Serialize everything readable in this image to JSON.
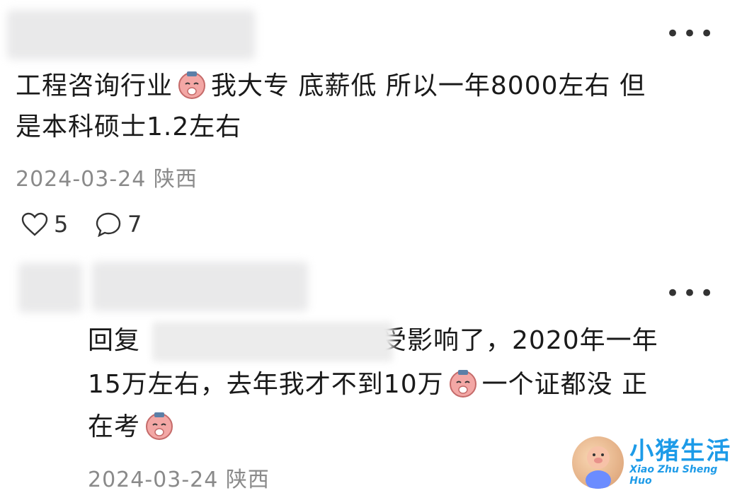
{
  "comment1": {
    "text_line1_part1": "工程咨询行业",
    "text_line1_part2": "我大专 底薪低 所以一年8000左右 但",
    "text_line2": "是本科硕士1.2左右",
    "date": "2024-03-24",
    "location": "陕西",
    "likes": "5",
    "replies": "7"
  },
  "comment2": {
    "reply_prefix": "回复",
    "line1_after": "受影响了，2020年一年",
    "line2_part1": "15万左右，去年我才不到10万",
    "line2_part2": "一个证都没 正",
    "line3": "在考",
    "date": "2024-03-24",
    "location": "陕西"
  },
  "watermark": {
    "title": "小猪生活",
    "subtitle": "Xiao Zhu Sheng Huo"
  },
  "colors": {
    "text": "#1a1a1a",
    "meta": "#8a8a8a",
    "watermark": "#1d9be8"
  }
}
